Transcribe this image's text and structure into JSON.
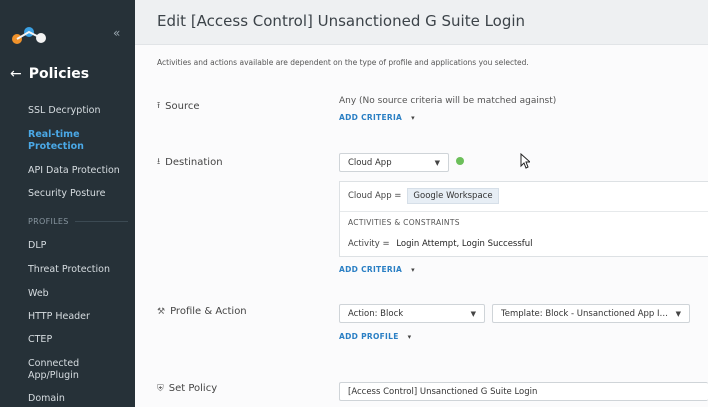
{
  "sidebar": {
    "back_label": "Policies",
    "items": [
      {
        "label": "SSL Decryption",
        "active": false
      },
      {
        "label": "Real-time Protection",
        "active": true
      },
      {
        "label": "API Data Protection",
        "active": false
      },
      {
        "label": "Security Posture",
        "active": false
      }
    ],
    "section_label": "PROFILES",
    "profile_items": [
      {
        "label": "DLP"
      },
      {
        "label": "Threat Protection"
      },
      {
        "label": "Web"
      },
      {
        "label": "HTTP Header"
      },
      {
        "label": "CTEP"
      },
      {
        "label": "Connected App/Plugin"
      },
      {
        "label": "Domain"
      }
    ]
  },
  "header": {
    "title": "Edit [Access Control] Unsanctioned G Suite Login"
  },
  "note": "Activities and actions available are dependent on the type of profile and applications you selected.",
  "source": {
    "label": "Source",
    "value": "Any (No source criteria will be matched against)",
    "add_link": "ADD CRITERIA"
  },
  "destination": {
    "label": "Destination",
    "select_value": "Cloud App",
    "criteria_label": "Cloud App =",
    "criteria_chip": "Google Workspace",
    "section_title": "ACTIVITIES & CONSTRAINTS",
    "activity_label": "Activity =",
    "activity_value": "Login Attempt, Login Successful",
    "add_link": "ADD CRITERIA"
  },
  "profile_action": {
    "label": "Profile & Action",
    "action_value": "Action: Block",
    "template_value": "Template: Block - Unsanctioned App Insta...",
    "add_link": "ADD PROFILE"
  },
  "set_policy": {
    "label": "Set Policy",
    "name_value": "[Access Control] Unsanctioned G Suite Login"
  },
  "colors": {
    "sidebar_bg": "#263138",
    "accent": "#2a7fc4",
    "active_nav": "#4aa8e6",
    "status_dot": "#6cbf5a"
  }
}
